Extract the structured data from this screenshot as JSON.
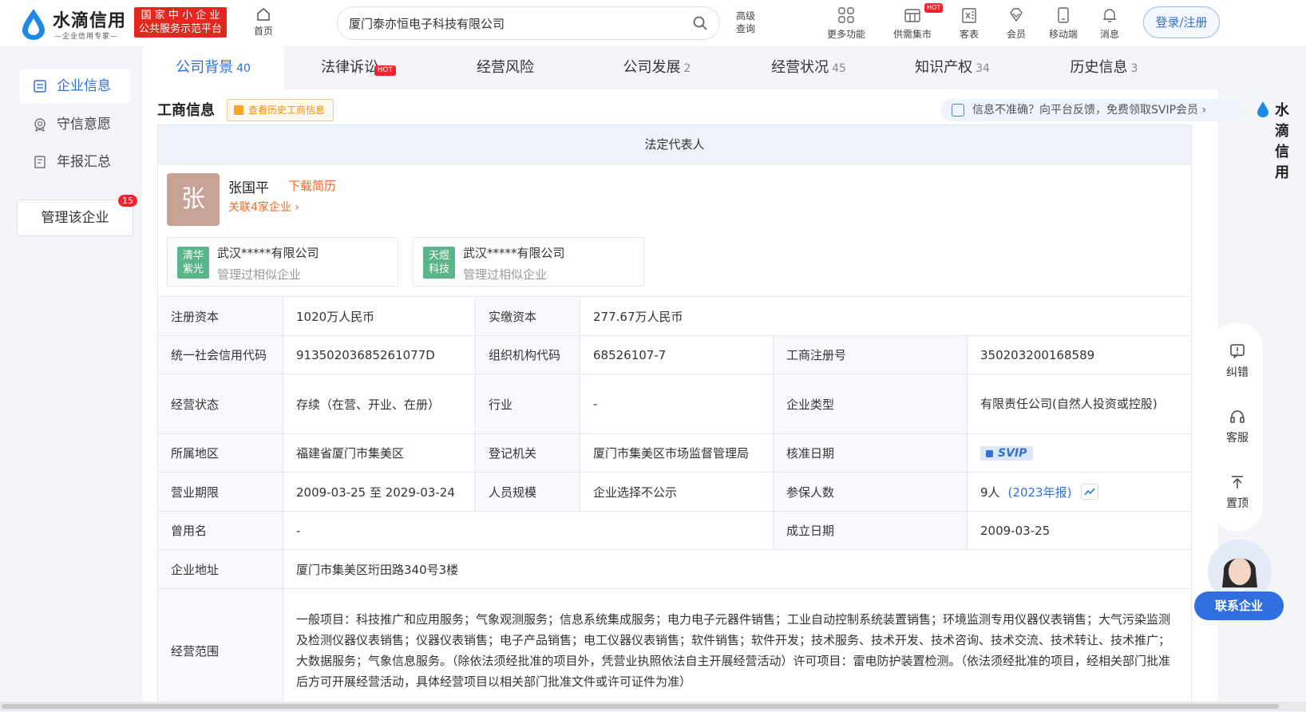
{
  "header": {
    "brand": "水滴信用",
    "brand_tag": "—企业信用专家—",
    "badge_line1": "国 家 中 小 企 业",
    "badge_line2": "公共服务示范平台",
    "home": "首页",
    "search_value": "厦门泰亦恒电子科技有限公司",
    "advanced_line1": "高级",
    "advanced_line2": "查询",
    "tools": [
      {
        "label": "更多功能",
        "icon": "grid-icon"
      },
      {
        "label": "供需集市",
        "icon": "market-icon",
        "badge": "HOT"
      },
      {
        "label": "客表",
        "icon": "excel-icon"
      },
      {
        "label": "会员",
        "icon": "diamond-icon"
      },
      {
        "label": "移动端",
        "icon": "mobile-icon"
      },
      {
        "label": "消息",
        "icon": "bell-icon"
      }
    ],
    "login": "登录/注册"
  },
  "sidebar": {
    "items": [
      {
        "label": "企业信息",
        "icon": "document-icon"
      },
      {
        "label": "守信意愿",
        "icon": "badge-icon"
      },
      {
        "label": "年报汇总",
        "icon": "report-icon"
      }
    ],
    "manage_label": "管理该企业",
    "manage_count": "15"
  },
  "tabs": [
    {
      "label": "公司背景",
      "count": "40"
    },
    {
      "label": "法律诉讼",
      "count": "",
      "badge": "HOT"
    },
    {
      "label": "经营风险",
      "count": ""
    },
    {
      "label": "公司发展",
      "count": "2"
    },
    {
      "label": "经营状况",
      "count": "45"
    },
    {
      "label": "知识产权",
      "count": "34"
    },
    {
      "label": "历史信息",
      "count": "3"
    }
  ],
  "section": {
    "title": "工商信息",
    "history_button": "查看历史工商信息",
    "feedback": "信息不准确？向平台反馈，免费领取SVIP会员 ›",
    "brand": "水滴信用"
  },
  "legal": {
    "header": "法定代表人",
    "avatar_char": "张",
    "name": "张国平",
    "resume": "下载简历",
    "related": "关联4家企业 ›",
    "companies": [
      {
        "logo_line1": "清华",
        "logo_line2": "紫光",
        "name": "武汉*****有限公司",
        "sub": "管理过相似企业"
      },
      {
        "logo_line1": "天煜",
        "logo_line2": "科技",
        "name": "武汉*****有限公司",
        "sub": "管理过相似企业"
      }
    ]
  },
  "info": {
    "reg_capital_label": "注册资本",
    "reg_capital": "1020万人民币",
    "paid_capital_label": "实缴资本",
    "paid_capital": "277.67万人民币",
    "credit_code_label": "统一社会信用代码",
    "credit_code": "91350203685261077D",
    "org_code_label": "组织机构代码",
    "org_code": "68526107-7",
    "reg_no_label": "工商注册号",
    "reg_no": "350203200168589",
    "status_label": "经营状态",
    "status": "存续（在营、开业、在册）",
    "industry_label": "行业",
    "industry": "-",
    "type_label": "企业类型",
    "type": "有限责任公司(自然人投资或控股)",
    "region_label": "所属地区",
    "region": "福建省厦门市集美区",
    "authority_label": "登记机关",
    "authority": "厦门市集美区市场监督管理局",
    "approve_label": "核准日期",
    "approve_value": "SVIP",
    "term_label": "营业期限",
    "term": "2009-03-25 至 2029-03-24",
    "staff_label": "人员规模",
    "staff": "企业选择不公示",
    "insured_label": "参保人数",
    "insured": "9人",
    "insured_year": "(2023年报)",
    "former_label": "曾用名",
    "former": "-",
    "founded_label": "成立日期",
    "founded": "2009-03-25",
    "address_label": "企业地址",
    "address": "厦门市集美区珩田路340号3楼",
    "scope_label": "经营范围",
    "scope": "一般项目：科技推广和应用服务；气象观测服务；信息系统集成服务；电力电子元器件销售；工业自动控制系统装置销售；环境监测专用仪器仪表销售；大气污染监测及检测仪器仪表销售；仪器仪表销售；电子产品销售；电工仪器仪表销售；软件销售；软件开发；技术服务、技术开发、技术咨询、技术交流、技术转让、技术推广；大数据服务；气象信息服务。（除依法须经批准的项目外，凭营业执照依法自主开展经营活动）许可项目：雷电防护装置检测。（依法须经批准的项目，经相关部门批准后方可开展经营活动，具体经营项目以相关部门批准文件或许可证件为准）"
  },
  "float_bar": {
    "items": [
      {
        "label": "纠错",
        "icon": "feedback-icon"
      },
      {
        "label": "客服",
        "icon": "headset-icon"
      },
      {
        "label": "置顶",
        "icon": "to-top-icon"
      }
    ],
    "contact": "联系企业"
  },
  "colors": {
    "accent": "#2f6fe0",
    "orange": "#f5691f",
    "red": "#e0281f"
  }
}
